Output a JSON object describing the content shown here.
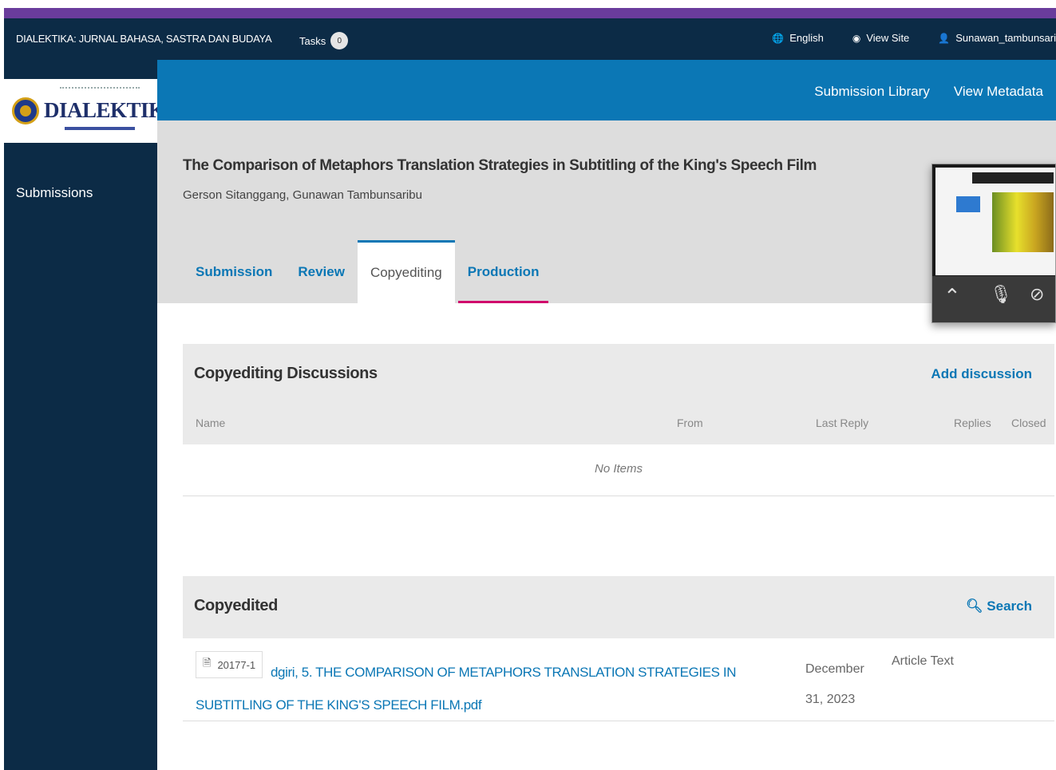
{
  "topbar": {
    "site_title": "DIALEKTIKA: JURNAL BAHASA, SASTRA DAN BUDAYA",
    "tasks_label": "Tasks",
    "tasks_count": "0",
    "language": "English",
    "view_site": "View Site",
    "username": "Sunawan_tambunsari"
  },
  "sidebar": {
    "logo_text": "DIALEKTIKA",
    "nav": [
      "Submissions"
    ]
  },
  "header": {
    "links": [
      "Submission Library",
      "View Metadata"
    ]
  },
  "submission": {
    "title": "The Comparison of Metaphors Translation Strategies in Subtitling of the King's Speech Film",
    "authors": "Gerson Sitanggang, Gunawan Tambunsaribu"
  },
  "tabs": [
    {
      "label": "Submission",
      "active": false
    },
    {
      "label": "Review",
      "active": false
    },
    {
      "label": "Copyediting",
      "active": true
    },
    {
      "label": "Production",
      "active": false
    }
  ],
  "discussions": {
    "title": "Copyediting Discussions",
    "action": "Add discussion",
    "columns": [
      "Name",
      "From",
      "Last Reply",
      "Replies",
      "Closed"
    ],
    "empty_text": "No Items"
  },
  "copyedited": {
    "title": "Copyedited",
    "action": "Search",
    "files": [
      {
        "id": "20177-1",
        "name": "dgiri, 5. THE COMPARISON OF METAPHORS TRANSLATION STRATEGIES IN SUBTITLING OF THE KING'S SPEECH FILM.pdf",
        "date": "December 31, 2023",
        "genre": "Article Text"
      }
    ]
  }
}
